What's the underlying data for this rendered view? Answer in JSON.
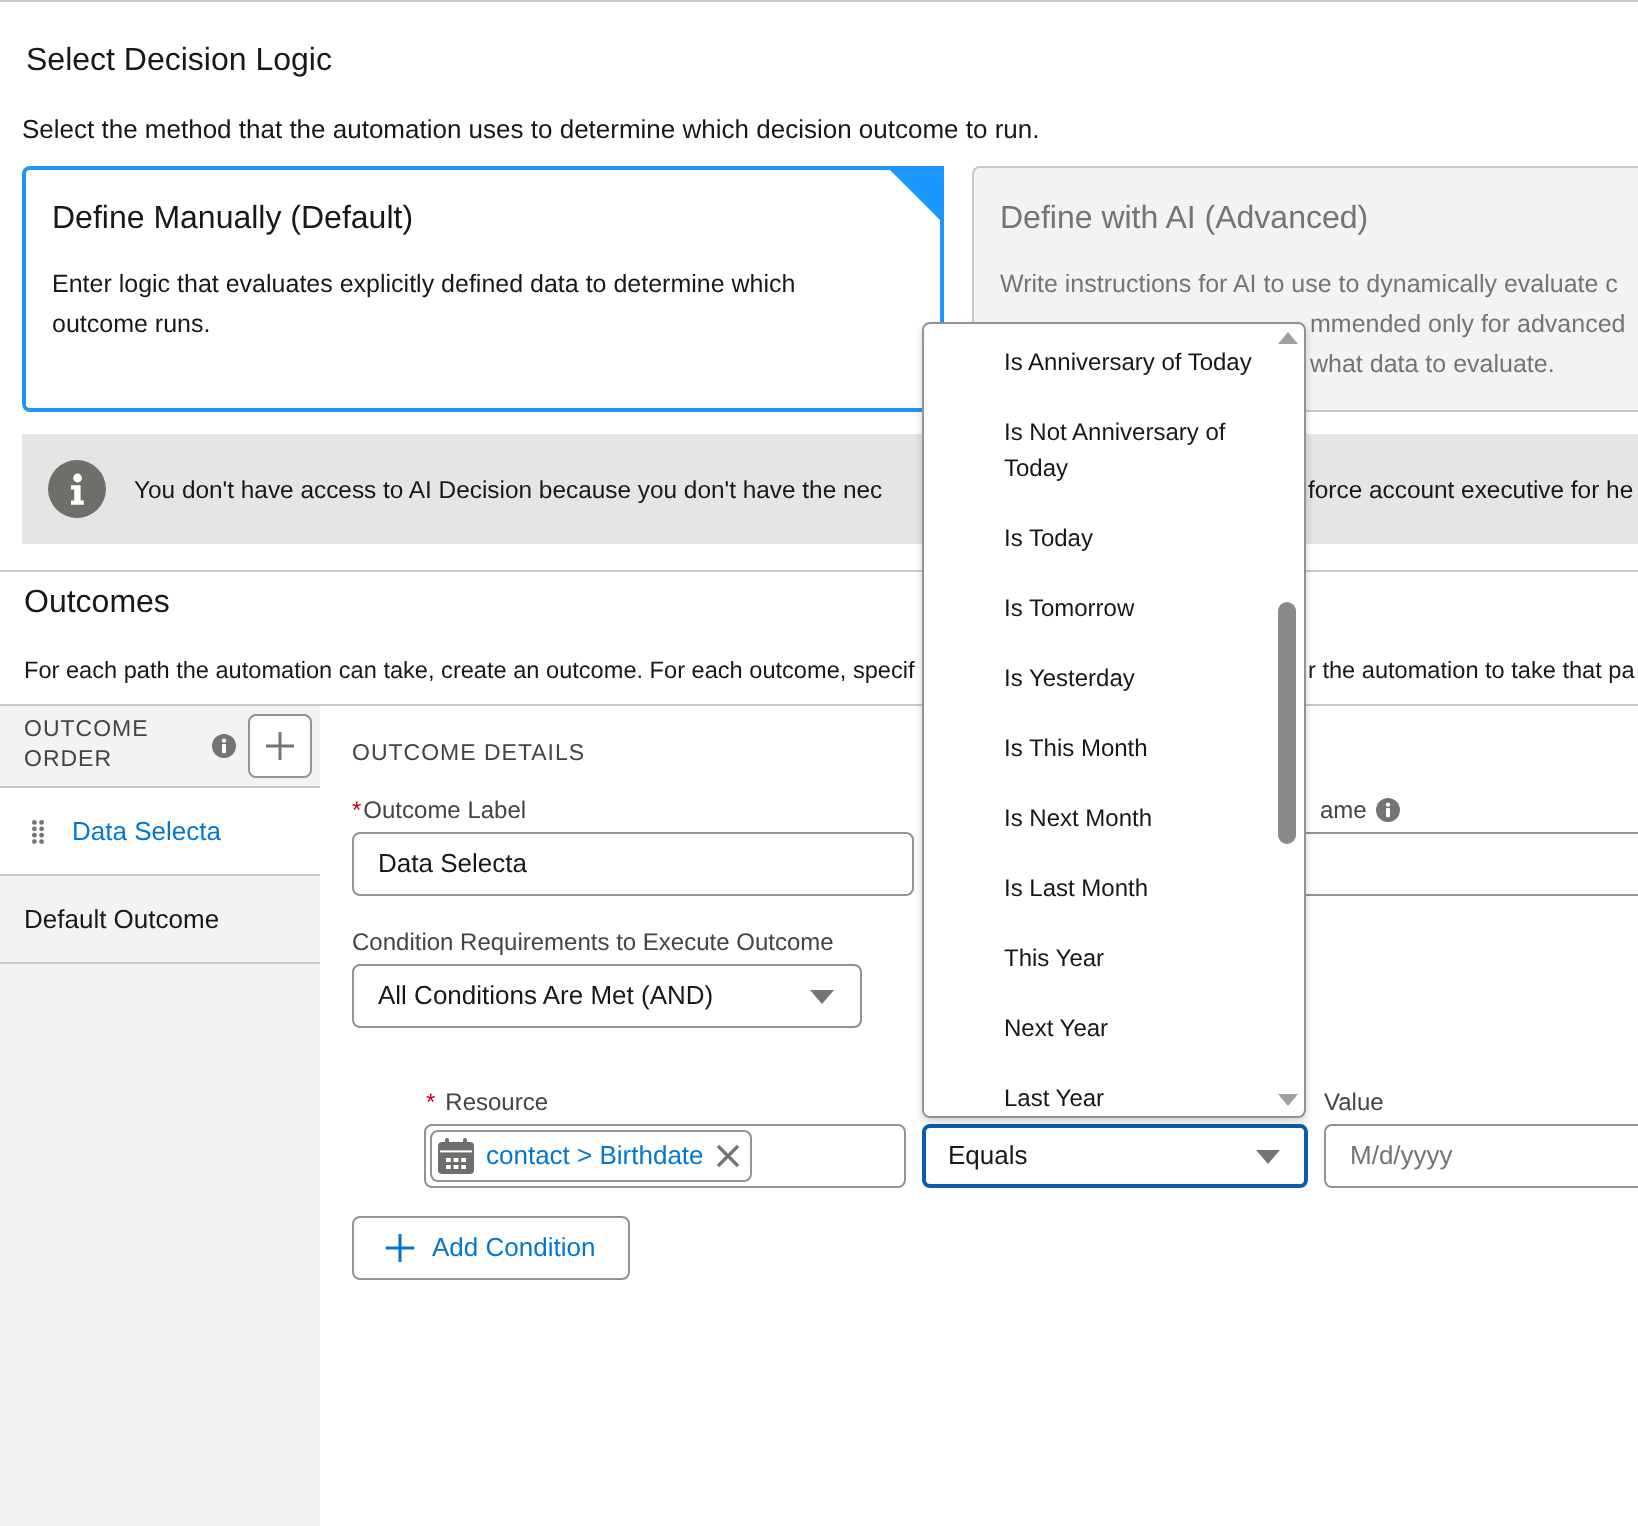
{
  "header": {
    "title": "Select Decision Logic",
    "description": "Select the method that the automation uses to determine which decision outcome to run."
  },
  "logic_options": [
    {
      "title": "Define Manually (Default)",
      "description": [
        "Enter logic that evaluates explicitly defined data to determine which outcome runs."
      ],
      "selected": true,
      "disabled": false
    },
    {
      "title": "Define with AI (Advanced)",
      "description": [
        "Write instructions for AI to use to dynamically evaluate c",
        "mmended only for advanced",
        "what data to evaluate."
      ],
      "selected": false,
      "disabled": true
    }
  ],
  "notice": {
    "text": [
      "You don't have access to AI Decision because you don't have the nec",
      "force account executive for he"
    ]
  },
  "outcomes": {
    "title": "Outcomes",
    "description": [
      "For each path the automation can take, create an outcome. For each outcome, specif",
      "r the automation to take that pa"
    ],
    "order": {
      "heading": "OUTCOME ORDER",
      "items": [
        {
          "label": "Data Selecta",
          "selected": true,
          "draggable": true
        },
        {
          "label": "Default Outcome",
          "selected": false,
          "draggable": false
        }
      ]
    },
    "details": {
      "heading": "OUTCOME DETAILS",
      "label_field": {
        "required_mark": "*",
        "label": "Outcome Label",
        "value": "Data Selecta"
      },
      "api_name_field": {
        "label": "ame"
      },
      "condition_logic": {
        "label": "Condition Requirements to Execute Outcome",
        "value": "All Conditions Are Met (AND)"
      },
      "condition": {
        "resource": {
          "required_mark": "*",
          "label": "Resource",
          "value": "contact > Birthdate"
        },
        "operator": {
          "value": "Equals",
          "expanded": true,
          "options": [
            {
              "label": "Is Anniversary of Today",
              "selected": false
            },
            {
              "label": "Is Not Anniversary of Today",
              "selected": false
            },
            {
              "label": "Is Today",
              "selected": false
            },
            {
              "label": "Is Tomorrow",
              "selected": false
            },
            {
              "label": "Is Yesterday",
              "selected": false
            },
            {
              "label": "Is This Month",
              "selected": false
            },
            {
              "label": "Is Next Month",
              "selected": false
            },
            {
              "label": "Is Last Month",
              "selected": false
            },
            {
              "label": "This Year",
              "selected": false
            },
            {
              "label": "Next Year",
              "selected": false
            },
            {
              "label": "Last Year",
              "selected": false
            }
          ]
        },
        "value_field": {
          "label": "Value",
          "placeholder": "M/d/yyyy"
        }
      },
      "add_condition": "Add Condition"
    }
  }
}
